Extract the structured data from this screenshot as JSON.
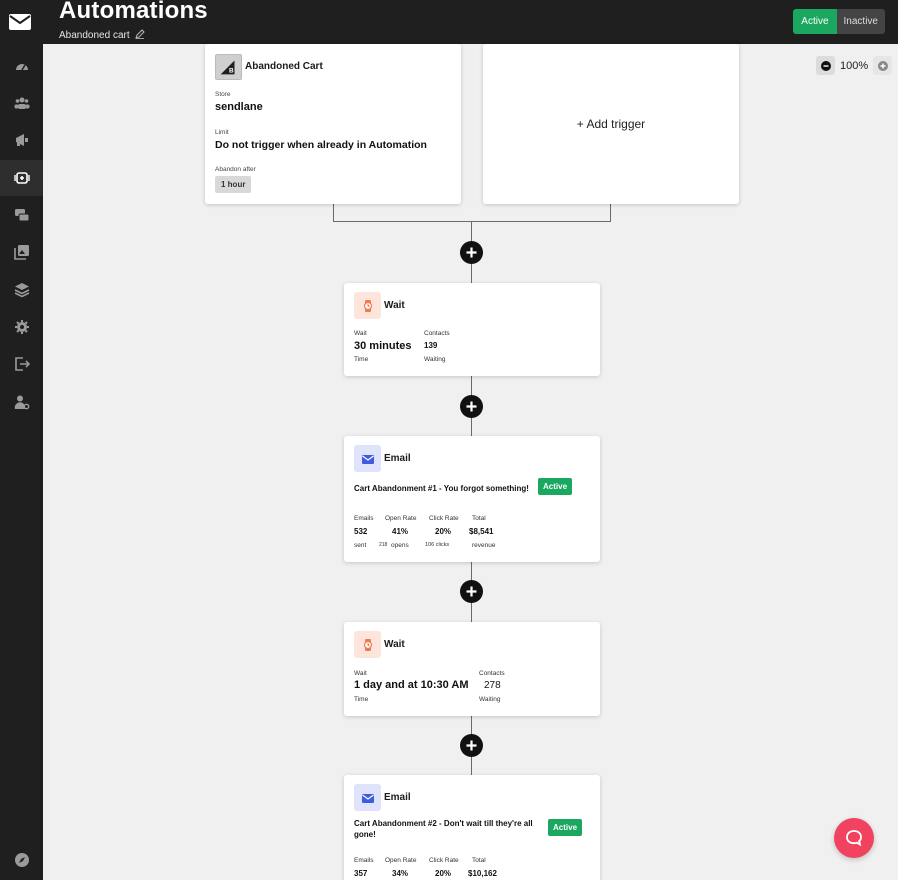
{
  "header": {
    "title": "Automations",
    "subtitle": "Abandoned cart",
    "status_active": "Active",
    "status_inactive": "Inactive"
  },
  "sidebar": {
    "items": [
      "dashboard-icon",
      "contacts-icon",
      "campaigns-icon",
      "automations-icon",
      "conversations-icon",
      "media-icon",
      "integrations-icon",
      "settings-icon",
      "logout-icon",
      "account-icon"
    ],
    "bottom": "compass-icon"
  },
  "zoom": {
    "level": "100%"
  },
  "trigger": {
    "title": "Abandoned Cart",
    "store_label": "Store",
    "store_value": "sendlane",
    "limit_label": "Limit",
    "limit_value": "Do not trigger when already in Automation",
    "abandon_label": "Abandon after",
    "abandon_value": "1 hour"
  },
  "add_trigger": {
    "label": "+ Add trigger"
  },
  "steps": {
    "wait1": {
      "title": "Wait",
      "wait_label": "Wait",
      "wait_value": "30 minutes",
      "wait_sub": "Time",
      "contacts_label": "Contacts",
      "contacts_value": "139",
      "contacts_sub": "Waiting"
    },
    "email1": {
      "title": "Email",
      "subject": "Cart Abandonment #1 - You forgot something!",
      "badge": "Active",
      "emails_label": "Emails",
      "emails_value": "532",
      "emails_sub": "sent",
      "open_label": "Open Rate",
      "open_value": "41%",
      "open_sub_num": "218",
      "open_sub": "opens",
      "click_label": "Click Rate",
      "click_value": "20%",
      "click_sub": "106 clicks",
      "total_label": "Total",
      "total_value": "$8,541",
      "total_sub": "revenue"
    },
    "wait2": {
      "title": "Wait",
      "wait_label": "Wait",
      "wait_value": "1 day and at 10:30 AM",
      "wait_sub": "Time",
      "contacts_label": "Contacts",
      "contacts_value": "278",
      "contacts_sub": "Waiting"
    },
    "email2": {
      "title": "Email",
      "subject": "Cart Abandonment #2 - Don't wait till they're all gone!",
      "badge": "Active",
      "emails_label": "Emails",
      "emails_value": "357",
      "open_label": "Open Rate",
      "open_value": "34%",
      "click_label": "Click Rate",
      "click_value": "20%",
      "total_label": "Total",
      "total_value": "$10,162"
    }
  },
  "colors": {
    "accent_green": "#1aa760",
    "chat_red": "#f1435f",
    "sidebar_bg": "#1f1f1f"
  }
}
